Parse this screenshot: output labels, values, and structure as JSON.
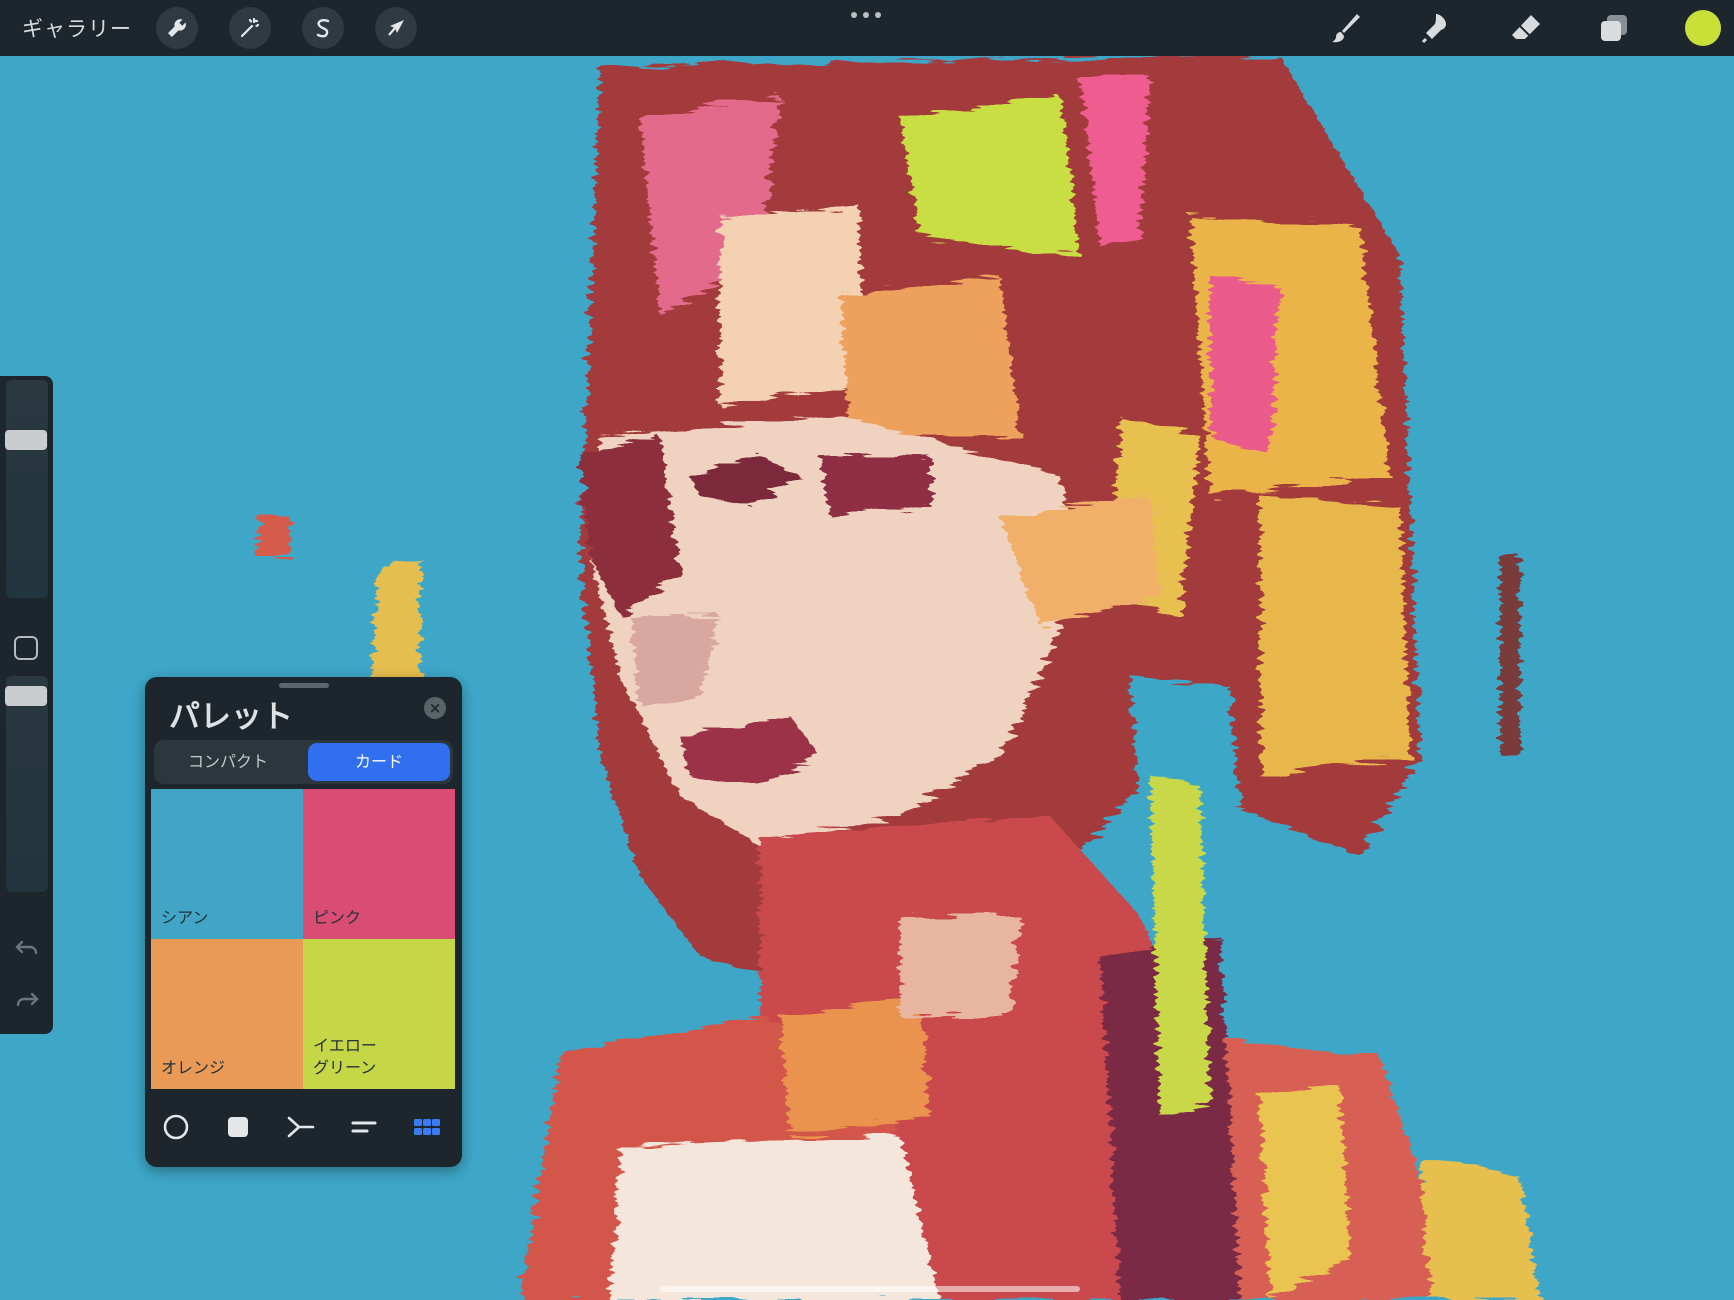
{
  "app": {
    "gallery_label": "ギャラリー",
    "current_color": "#c9e038"
  },
  "toolbar": {
    "left_tools": [
      "wrench-icon",
      "magic-wand-icon",
      "selection-icon",
      "transform-arrow-icon"
    ],
    "right_tools": [
      "brush-icon",
      "smudge-icon",
      "eraser-icon",
      "layers-icon"
    ]
  },
  "sidebar": {
    "brush_size_level": 0.75,
    "opacity_level": 0.95
  },
  "palette": {
    "title": "パレット",
    "tabs": [
      {
        "label": "コンパクト",
        "active": false
      },
      {
        "label": "カード",
        "active": true
      }
    ],
    "swatches": [
      {
        "label": "シアン",
        "color": "#41a6c6"
      },
      {
        "label": "ピンク",
        "color": "#d94c73"
      },
      {
        "label": "オレンジ",
        "color": "#e99a56"
      },
      {
        "label": "イエロー\nグリーン",
        "color": "#c5d647"
      }
    ],
    "bottom_tools": [
      "disc-icon",
      "square-icon",
      "harmony-icon",
      "value-icon",
      "palette-grid-icon"
    ],
    "accent_color": "#2f6ff0"
  }
}
